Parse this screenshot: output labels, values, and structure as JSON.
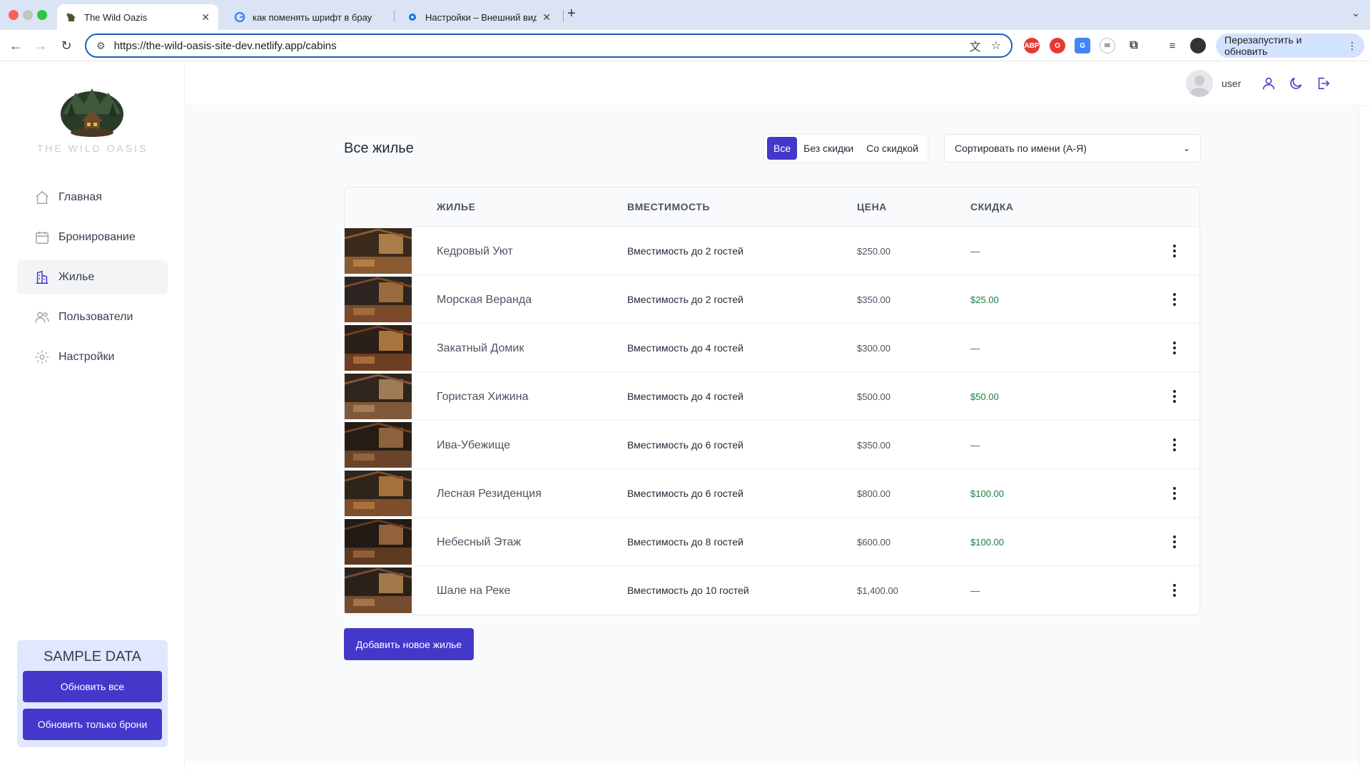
{
  "browser": {
    "tabs": [
      {
        "title": "The Wild Oazis",
        "icon": "cabin-favicon-icon"
      },
      {
        "title": "как поменять шрифт в брау",
        "icon": "google-icon"
      },
      {
        "title": "Настройки – Внешний вид",
        "icon": "settings-gear-icon"
      }
    ],
    "url": "https://the-wild-oasis-site-dev.netlify.app/cabins",
    "relaunch_label": "Перезапустить и обновить"
  },
  "sidebar": {
    "brand": "THE WILD OASIS",
    "items": [
      {
        "label": "Главная",
        "icon": "home-icon"
      },
      {
        "label": "Бронирование",
        "icon": "calendar-icon"
      },
      {
        "label": "Жилье",
        "icon": "buildings-icon"
      },
      {
        "label": "Пользователи",
        "icon": "users-icon"
      },
      {
        "label": "Настройки",
        "icon": "gear-icon"
      }
    ],
    "sample_title": "SAMPLE DATA",
    "sample_buttons": [
      "Обновить все",
      "Обновить только брони"
    ]
  },
  "header": {
    "username": "user",
    "icons": [
      "user-icon",
      "moon-icon",
      "logout-icon"
    ]
  },
  "main": {
    "title": "Все жилье",
    "filters": [
      "Все",
      "Без скидки",
      "Со скидкой"
    ],
    "active_filter": "Все",
    "sort_label": "Сортировать по имени (A-Я)",
    "columns": [
      "ЖИЛЬЕ",
      "ВМЕСТИМОСТЬ",
      "ЦЕНА",
      "СКИДКА"
    ],
    "rows": [
      {
        "name": "Кедровый Уют",
        "capacity": "Вместимость до 2 гостей",
        "price": "$250.00",
        "discount": "—"
      },
      {
        "name": "Морская Веранда",
        "capacity": "Вместимость до 2 гостей",
        "price": "$350.00",
        "discount": "$25.00"
      },
      {
        "name": "Закатный Домик",
        "capacity": "Вместимость до 4 гостей",
        "price": "$300.00",
        "discount": "—"
      },
      {
        "name": "Гористая Хижина",
        "capacity": "Вместимость до 4 гостей",
        "price": "$500.00",
        "discount": "$50.00"
      },
      {
        "name": "Ива-Убежище",
        "capacity": "Вместимость до 6 гостей",
        "price": "$350.00",
        "discount": "—"
      },
      {
        "name": "Лесная Резиденция",
        "capacity": "Вместимость до 6 гостей",
        "price": "$800.00",
        "discount": "$100.00"
      },
      {
        "name": "Небесный Этаж",
        "capacity": "Вместимость до 8 гостей",
        "price": "$600.00",
        "discount": "$100.00"
      },
      {
        "name": "Шале на Реке",
        "capacity": "Вместимость до 10 гостей",
        "price": "$1,400.00",
        "discount": "—"
      }
    ],
    "add_button": "Добавить новое жилье"
  },
  "colors": {
    "accent": "#4338ca",
    "discount_green": "#15803d",
    "sidebar_active_bg": "#f3f4f6",
    "sample_panel_bg": "#e0e7ff"
  }
}
